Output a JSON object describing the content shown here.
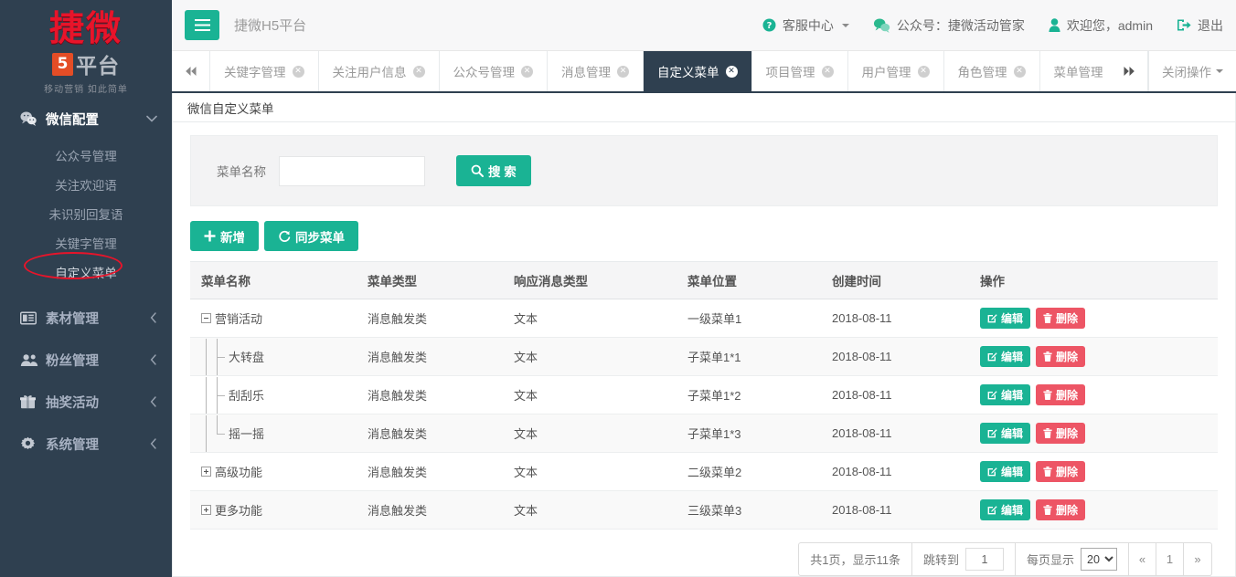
{
  "sidebar": {
    "logo": {
      "main": "捷微",
      "badge": "5",
      "platform": "平台",
      "tagline": "移动营销 如此简单"
    },
    "groups": [
      {
        "label": "微信配置",
        "icon": "wechat-icon",
        "caret": "chevron-down-icon",
        "items": [
          {
            "label": "公众号管理"
          },
          {
            "label": "关注欢迎语"
          },
          {
            "label": "未识别回复语"
          },
          {
            "label": "关键字管理"
          },
          {
            "label": "自定义菜单"
          }
        ]
      },
      {
        "label": "素材管理",
        "icon": "newspaper-icon",
        "caret": "chevron-left-icon",
        "items": []
      },
      {
        "label": "粉丝管理",
        "icon": "users-icon",
        "caret": "chevron-left-icon",
        "items": []
      },
      {
        "label": "抽奖活动",
        "icon": "gift-icon",
        "caret": "chevron-left-icon",
        "items": []
      },
      {
        "label": "系统管理",
        "icon": "gear-icon",
        "caret": "chevron-left-icon",
        "items": []
      }
    ]
  },
  "topbar": {
    "menu_toggle_icon": "hamburger-icon",
    "brand_title": "捷微H5平台",
    "links": [
      {
        "label": "客服中心",
        "icon": "question-circle-icon",
        "has_caret": true
      },
      {
        "label": "公众号：捷微活动管家",
        "icon": "wechat-icon",
        "has_caret": false
      },
      {
        "label": "欢迎您，admin",
        "icon": "user-icon",
        "has_caret": false
      },
      {
        "label": "退出",
        "icon": "logout-icon",
        "has_caret": false
      }
    ]
  },
  "tabs": {
    "scroll_left_icon": "double-left-icon",
    "scroll_right_icon": "double-right-icon",
    "items": [
      {
        "label": "关键字管理",
        "active": false
      },
      {
        "label": "关注用户信息",
        "active": false
      },
      {
        "label": "公众号管理",
        "active": false
      },
      {
        "label": "消息管理",
        "active": false
      },
      {
        "label": "自定义菜单",
        "active": true
      },
      {
        "label": "项目管理",
        "active": false
      },
      {
        "label": "用户管理",
        "active": false
      },
      {
        "label": "角色管理",
        "active": false
      },
      {
        "label": "菜单管理",
        "active": false
      }
    ],
    "close_label": "关闭操作",
    "close_icon": "circle-x-icon"
  },
  "panel": {
    "title": "微信自定义菜单",
    "search": {
      "label": "菜单名称",
      "value": "",
      "placeholder": "",
      "button_label": "搜 索",
      "button_icon": "search-icon"
    },
    "toolbar": {
      "add_label": "新增",
      "add_icon": "plus-icon",
      "sync_label": "同步菜单",
      "sync_icon": "refresh-icon"
    },
    "table": {
      "headers": [
        "菜单名称",
        "菜单类型",
        "响应消息类型",
        "菜单位置",
        "创建时间",
        "操作"
      ],
      "rows": [
        {
          "name": "营销活动",
          "level": 0,
          "toggle": "minus",
          "type": "消息触发类",
          "msg_type": "文本",
          "position": "一级菜单1",
          "created": "2018-08-11"
        },
        {
          "name": "大转盘",
          "level": 1,
          "toggle": "branch",
          "type": "消息触发类",
          "msg_type": "文本",
          "position": "子菜单1*1",
          "created": "2018-08-11"
        },
        {
          "name": "刮刮乐",
          "level": 1,
          "toggle": "branch",
          "type": "消息触发类",
          "msg_type": "文本",
          "position": "子菜单1*2",
          "created": "2018-08-11"
        },
        {
          "name": "摇一摇",
          "level": 1,
          "toggle": "branch-last",
          "type": "消息触发类",
          "msg_type": "文本",
          "position": "子菜单1*3",
          "created": "2018-08-11"
        },
        {
          "name": "高级功能",
          "level": 0,
          "toggle": "plus",
          "type": "消息触发类",
          "msg_type": "文本",
          "position": "二级菜单2",
          "created": "2018-08-11"
        },
        {
          "name": "更多功能",
          "level": 0,
          "toggle": "plus",
          "type": "消息触发类",
          "msg_type": "文本",
          "position": "三级菜单3",
          "created": "2018-08-11"
        }
      ],
      "actions": {
        "edit_label": "编辑",
        "edit_icon": "edit-square-icon",
        "delete_label": "删除",
        "delete_icon": "trash-icon"
      }
    },
    "pagination": {
      "summary": "共1页，显示11条",
      "jump_label": "跳转到",
      "jump_value": "1",
      "page_size_label": "每页显示",
      "page_size_value": "20",
      "first_label": "«",
      "current_page": "1",
      "last_label": "»"
    }
  },
  "colors": {
    "sidebar_bg": "#2f4050",
    "accent_green": "#1ab394",
    "danger_red": "#ed5565",
    "logo_red": "#e8142a",
    "highlight_ellipse": "#e8142a"
  }
}
